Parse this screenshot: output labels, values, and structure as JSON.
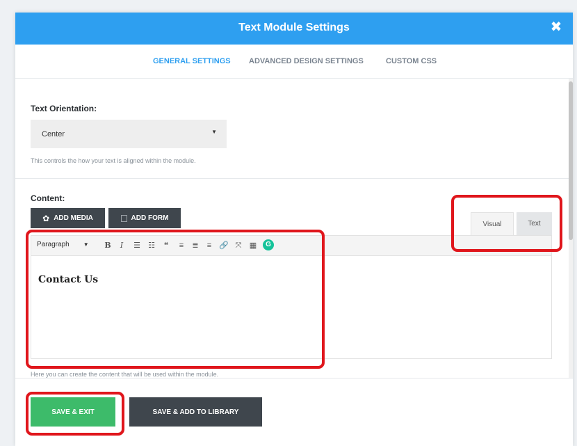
{
  "header": {
    "title": "Text Module Settings",
    "close_glyph": "✖",
    "close_icon": "close-icon"
  },
  "tabs": [
    {
      "label": "GENERAL SETTINGS",
      "active": true
    },
    {
      "label": "ADVANCED DESIGN SETTINGS",
      "active": false
    },
    {
      "label": "CUSTOM CSS",
      "active": false
    }
  ],
  "orientation": {
    "label": "Text Orientation:",
    "value": "Center",
    "help": "This controls the how your text is aligned within the module."
  },
  "content": {
    "label": "Content:",
    "add_media": "ADD MEDIA",
    "add_form": "ADD FORM",
    "editor_tabs": [
      "Visual",
      "Text"
    ],
    "format_select": "Paragraph",
    "body_heading": "Contact Us",
    "help": "Here you can create the content that will be used within the module."
  },
  "toolbar_icons": [
    {
      "name": "bold-icon",
      "glyph": "B"
    },
    {
      "name": "italic-icon",
      "glyph": "I"
    },
    {
      "name": "bullet-list-icon",
      "glyph": "☰"
    },
    {
      "name": "numbered-list-icon",
      "glyph": "☷"
    },
    {
      "name": "blockquote-icon",
      "glyph": "❝"
    },
    {
      "name": "align-left-icon",
      "glyph": "≡"
    },
    {
      "name": "align-center-icon",
      "glyph": "≣"
    },
    {
      "name": "align-right-icon",
      "glyph": "≡"
    },
    {
      "name": "link-icon",
      "glyph": "🔗"
    },
    {
      "name": "fullscreen-icon",
      "glyph": "⤧"
    },
    {
      "name": "toolbar-toggle-icon",
      "glyph": "▦"
    },
    {
      "name": "grammarly-icon",
      "glyph": "G"
    }
  ],
  "footer": {
    "save_exit": "SAVE & EXIT",
    "save_library": "SAVE & ADD TO LIBRARY"
  },
  "colors": {
    "accent": "#2e9ff0",
    "save": "#3dbb6a",
    "dark_button": "#3f464d",
    "highlight": "#e0161c"
  }
}
